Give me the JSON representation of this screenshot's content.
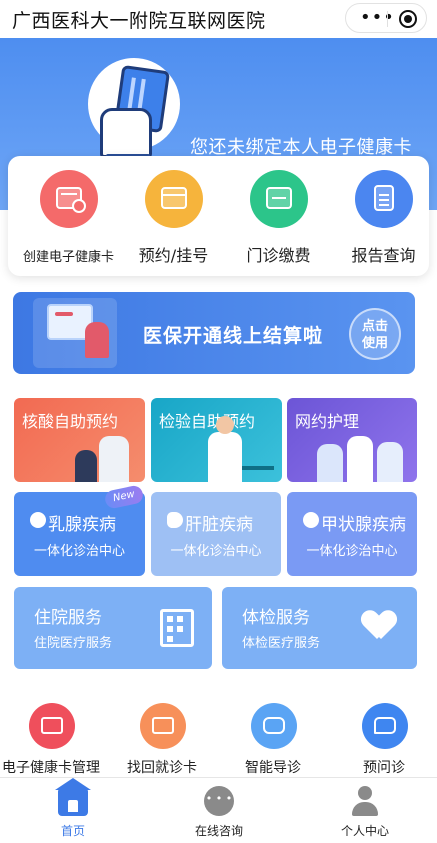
{
  "header": {
    "title": "广西医科大一附院互联网医院"
  },
  "banner": {
    "bind_text": "您还未绑定本人电子健康卡"
  },
  "quick_actions": [
    {
      "label": "创建电子健康卡",
      "icon": "add-card-icon",
      "color": "#f46a6a"
    },
    {
      "label": "预约/挂号",
      "icon": "calendar-icon",
      "color": "#f6b43c"
    },
    {
      "label": "门诊缴费",
      "icon": "bill-icon",
      "color": "#2cc58a"
    },
    {
      "label": "报告查询",
      "icon": "report-icon",
      "color": "#4b86f0"
    }
  ],
  "promo": {
    "text": "医保开通线上结算啦",
    "button": "点击\n使用"
  },
  "tiles_row1": [
    {
      "label": "核酸自助预约"
    },
    {
      "label": "检验自助预约"
    },
    {
      "label": "网约护理"
    }
  ],
  "tiles_row2": [
    {
      "label": "乳腺疾病",
      "sub": "一体化诊治中心",
      "badge": "New",
      "icon": "ribbon-icon"
    },
    {
      "label": "肝脏疾病",
      "sub": "一体化诊治中心",
      "icon": "liver-icon"
    },
    {
      "label": "甲状腺疾病",
      "sub": "一体化诊治中心",
      "icon": "plus-circle-icon"
    }
  ],
  "tiles_row3": [
    {
      "label": "住院服务",
      "sub": "住院医疗服务",
      "icon": "hospital-building-icon"
    },
    {
      "label": "体检服务",
      "sub": "体检医疗服务",
      "icon": "heartbeat-icon"
    }
  ],
  "shortcuts": [
    {
      "label": "电子健康卡管理",
      "icon": "health-card-icon"
    },
    {
      "label": "找回就诊卡",
      "icon": "find-card-icon"
    },
    {
      "label": "智能导诊",
      "icon": "robot-icon"
    },
    {
      "label": "预问诊",
      "icon": "chat-plus-icon"
    }
  ],
  "tabbar": [
    {
      "label": "首页",
      "active": true,
      "icon": "home-icon"
    },
    {
      "label": "在线咨询",
      "active": false,
      "icon": "chat-icon"
    },
    {
      "label": "个人中心",
      "active": false,
      "icon": "user-icon"
    }
  ]
}
